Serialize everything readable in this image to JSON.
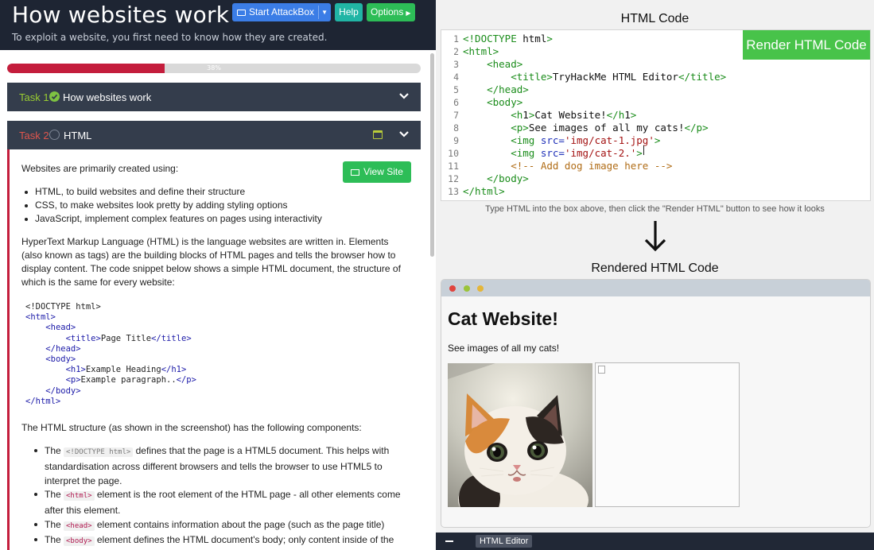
{
  "room": {
    "title": "How websites work",
    "subtitle": "To exploit a website, you first need to know how they are created.",
    "buttons": {
      "attackbox": "Start AttackBox",
      "help": "Help",
      "options": "Options"
    }
  },
  "progress": {
    "value": 0.38,
    "label": "38%"
  },
  "tasks": [
    {
      "number": "Task 1",
      "title": "How websites work",
      "completed": true
    },
    {
      "number": "Task 2",
      "title": "HTML",
      "completed": false
    }
  ],
  "content": {
    "view_site": "View Site",
    "intro": "Websites are primarily created using:",
    "bullets": [
      "HTML, to build websites and define their structure",
      "CSS, to make websites look pretty by adding styling options",
      "JavaScript, implement complex features on pages using interactivity"
    ],
    "para1": "HyperText Markup Language (HTML) is the language websites are written in. Elements (also known as tags) are the building blocks of HTML pages and tells the browser how to display content. The code snippet below shows a simple HTML document, the structure of which is the same for every website:",
    "code_sample": [
      "<!DOCTYPE html>",
      "<html>",
      "    <head>",
      "        <title>Page Title</title>",
      "    </head>",
      "    <body>",
      "        <h1>Example Heading</h1>",
      "        <p>Example paragraph..</p>",
      "    </body>",
      "</html>"
    ],
    "para2": "The HTML structure (as shown in the screenshot) has the following components:",
    "components": [
      {
        "code": "<!DOCTYPE html>",
        "pre": "The ",
        "text": " defines that the page is a HTML5 document. This helps with standardisation across different browsers and tells the browser to use HTML5 to interpret the page."
      },
      {
        "code": "<html>",
        "pre": "The ",
        "text": " element is the root element of the HTML page - all other elements come after this element."
      },
      {
        "code": "<head>",
        "pre": "The ",
        "text": " element contains information about the page (such as the page title)"
      },
      {
        "code": "<body>",
        "pre": "The ",
        "text": " element defines the HTML document's body; only content inside of the"
      }
    ]
  },
  "editor": {
    "title": "HTML Code",
    "render_button": "Render HTML Code",
    "lines": [
      "<!DOCTYPE html>",
      "<html>",
      "    <head>",
      "        <title>TryHackMe HTML Editor</title>",
      "    </head>",
      "    <body>",
      "        <h1>Cat Website!</h1>",
      "        <p>See images of all my cats!</p>",
      "        <img src='img/cat-1.jpg'>",
      "        <img src='img/cat-2.'>",
      "        <!-- Add dog image here -->",
      "    </body>",
      "</html>"
    ],
    "hint": "Type HTML into the box above, then click the \"Render HTML\" button to see how it looks",
    "arrow_icon": "down-arrow-icon"
  },
  "rendered": {
    "title": "Rendered HTML Code",
    "h1": "Cat Website!",
    "p": "See images of all my cats!"
  },
  "bottom_bar": {
    "tab": "HTML Editor"
  },
  "colors": {
    "header_bg": "#1e2533",
    "task_bar_bg": "#343d4c",
    "accent_red": "#c41d3c",
    "green": "#2dbd57",
    "render_green": "#48c34a"
  }
}
